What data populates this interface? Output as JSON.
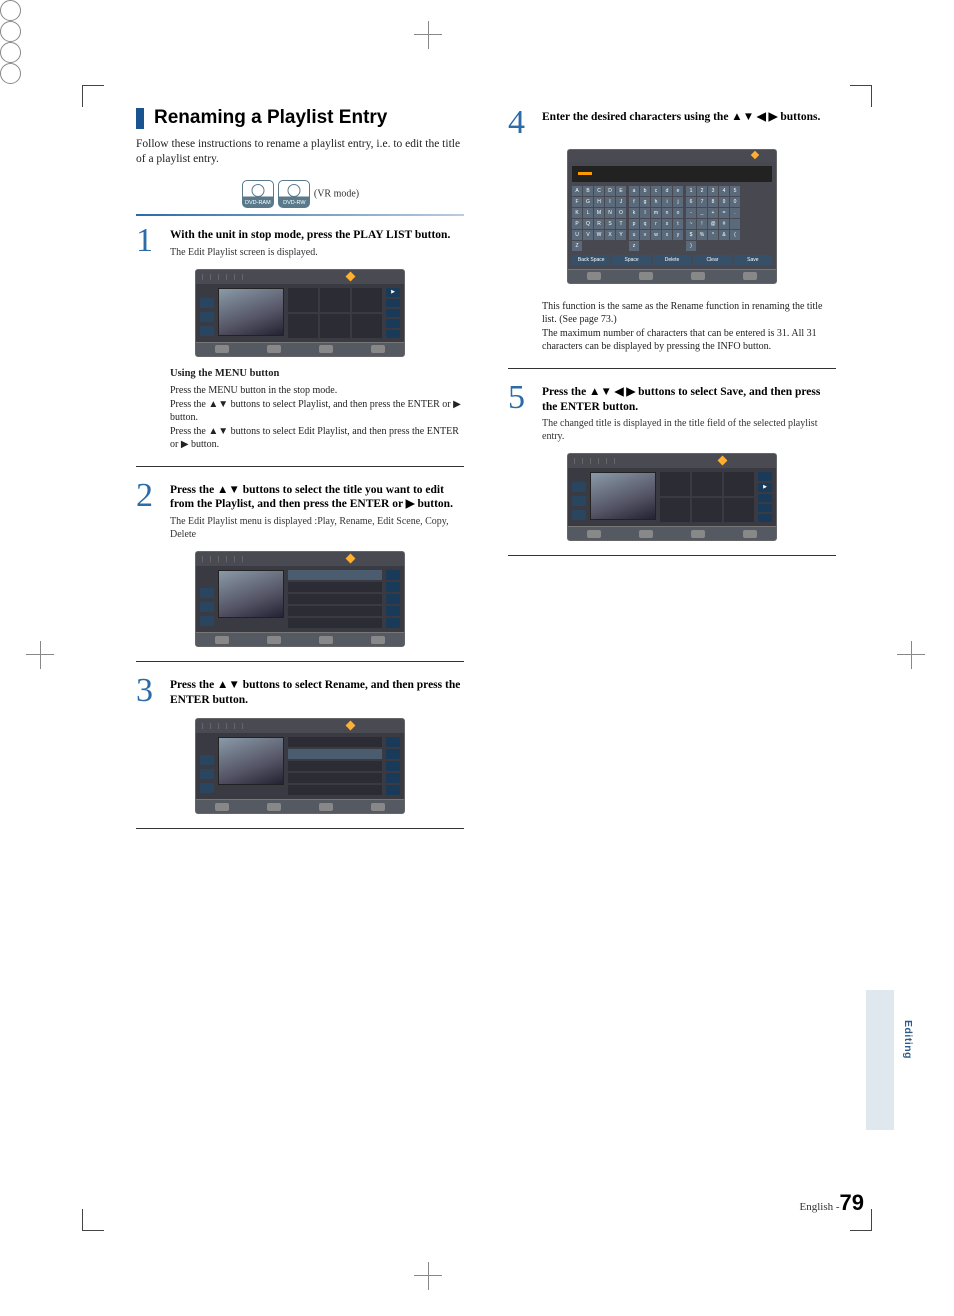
{
  "title": "Renaming a Playlist Entry",
  "intro": "Follow these instructions to rename a playlist entry, i.e. to edit the title of a playlist entry.",
  "discs": {
    "ram": "DVD-RAM",
    "rw": "DVD-RW",
    "mode": "(VR mode)"
  },
  "steps": {
    "s1": {
      "num": "1",
      "text": "With the unit in stop mode, press the PLAY LIST button.",
      "sub": "The Edit Playlist screen is displayed."
    },
    "menu_block": {
      "header": "Using the MENU button",
      "l1": "Press the MENU button in the stop mode.",
      "l2": "Press the ▲▼ buttons to select Playlist, and then press the ENTER or ▶ button.",
      "l3": "Press the ▲▼ buttons to select Edit Playlist, and then press the ENTER or ▶ button."
    },
    "s2": {
      "num": "2",
      "text": "Press the ▲▼ buttons to select the title you want to edit from the Playlist, and then press the ENTER or ▶ button.",
      "sub": "The Edit Playlist menu is displayed :Play, Rename, Edit Scene, Copy, Delete"
    },
    "s3": {
      "num": "3",
      "text": "Press the ▲▼ buttons to select Rename, and then press the ENTER button."
    },
    "s4": {
      "num": "4",
      "text": "Enter the desired characters using the ▲▼ ◀ ▶ buttons."
    },
    "s4_note": {
      "l1": "This function is the same as the Rename function in renaming the title list. (See page 73.)",
      "l2": "The maximum number of characters that can be entered is 31. All 31 characters can be displayed by pressing the INFO button."
    },
    "s5": {
      "num": "5",
      "text": "Press the ▲▼ ◀ ▶ buttons to select Save, and then press the ENTER button.",
      "sub": "The changed title is displayed in the title field of the selected playlist entry."
    }
  },
  "keyboard": {
    "upper": [
      "A",
      "B",
      "C",
      "D",
      "E",
      "F",
      "G",
      "H",
      "I",
      "J",
      "K",
      "L",
      "M",
      "N",
      "O",
      "P",
      "Q",
      "R",
      "S",
      "T",
      "U",
      "V",
      "W",
      "X",
      "Y",
      "Z"
    ],
    "lower": [
      "a",
      "b",
      "c",
      "d",
      "e",
      "f",
      "g",
      "h",
      "i",
      "j",
      "k",
      "l",
      "m",
      "n",
      "o",
      "p",
      "q",
      "r",
      "s",
      "t",
      "u",
      "v",
      "w",
      "x",
      "y",
      "z"
    ],
    "num": [
      "1",
      "2",
      "3",
      "4",
      "5",
      "6",
      "7",
      "8",
      "9",
      "0",
      "-",
      "_",
      "+",
      "=",
      ".",
      "~",
      "!",
      "@",
      "#",
      "",
      "$",
      "%",
      "^",
      "&",
      "(",
      ")"
    ],
    "actions": [
      "Back Space",
      "Space",
      "Delete",
      "Clear",
      "Save"
    ]
  },
  "tab": "Editing",
  "footer": {
    "lang": "English -",
    "page": "79"
  }
}
